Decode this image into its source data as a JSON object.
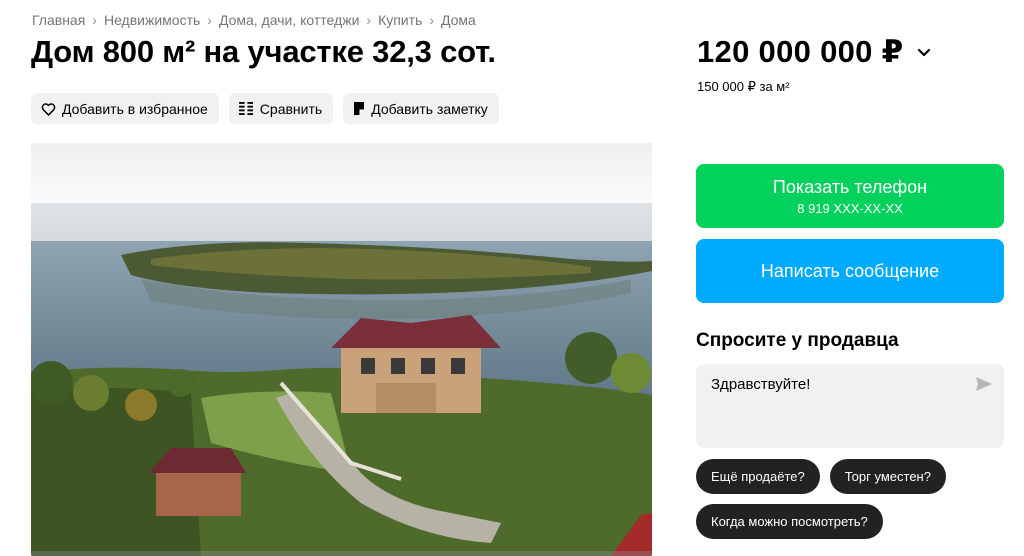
{
  "breadcrumb": [
    "Главная",
    "Недвижимость",
    "Дома, дачи, коттеджи",
    "Купить",
    "Дома"
  ],
  "title": "Дом 800 м² на участке 32,3 сот.",
  "actions": {
    "favorite": "Добавить в избранное",
    "compare": "Сравнить",
    "note": "Добавить заметку"
  },
  "price": {
    "value": "120 000 000 ₽",
    "per_m2": "150 000 ₽ за м²"
  },
  "contact": {
    "show_phone": "Показать телефон",
    "phone_masked": "8 919 XXX-XX-XX",
    "write_message": "Написать сообщение"
  },
  "ask": {
    "title": "Спросите у продавца",
    "message": "Здравствуйте!",
    "chips": [
      "Ещё продаёте?",
      "Торг уместен?",
      "Когда можно посмотреть?"
    ]
  },
  "colors": {
    "accent_green": "#02d15c",
    "accent_blue": "#00aaff",
    "chip_bg": "#222222",
    "button_bg": "#f2f1f0"
  },
  "icons": {
    "favorite": "heart-icon",
    "compare": "compare-icon",
    "note": "note-icon",
    "price_toggle": "chevron-down-icon",
    "send": "send-icon"
  }
}
